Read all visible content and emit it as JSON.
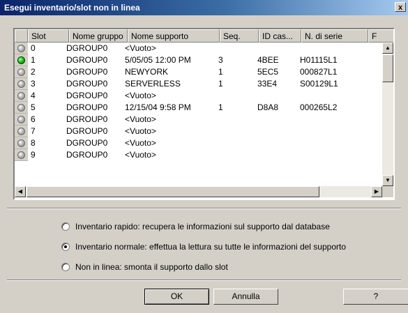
{
  "window": {
    "title": "Esegui inventario/slot non in linea",
    "close_label": "x"
  },
  "grid": {
    "columns": [
      "Slot",
      "Nome gruppo",
      "Nome supporto",
      "Seq.",
      "ID cas...",
      "N. di serie",
      "F"
    ],
    "rows": [
      {
        "slot": "0",
        "group": "DGROUP0",
        "media": "<Vuoto>",
        "seq": "",
        "cas": "",
        "serial": "",
        "active": false
      },
      {
        "slot": "1",
        "group": "DGROUP0",
        "media": "5/05/05 12:00 PM",
        "seq": "3",
        "cas": "4BEE",
        "serial": "H01115L1",
        "active": true
      },
      {
        "slot": "2",
        "group": "DGROUP0",
        "media": "NEWYORK",
        "seq": "1",
        "cas": "5EC5",
        "serial": "000827L1",
        "active": false
      },
      {
        "slot": "3",
        "group": "DGROUP0",
        "media": "SERVERLESS",
        "seq": "1",
        "cas": "33E4",
        "serial": "S00129L1",
        "active": false
      },
      {
        "slot": "4",
        "group": "DGROUP0",
        "media": "<Vuoto>",
        "seq": "",
        "cas": "",
        "serial": "",
        "active": false
      },
      {
        "slot": "5",
        "group": "DGROUP0",
        "media": "12/15/04 9:58 PM",
        "seq": "1",
        "cas": "D8A8",
        "serial": "000265L2",
        "active": false
      },
      {
        "slot": "6",
        "group": "DGROUP0",
        "media": "<Vuoto>",
        "seq": "",
        "cas": "",
        "serial": "",
        "active": false
      },
      {
        "slot": "7",
        "group": "DGROUP0",
        "media": "<Vuoto>",
        "seq": "",
        "cas": "",
        "serial": "",
        "active": false
      },
      {
        "slot": "8",
        "group": "DGROUP0",
        "media": "<Vuoto>",
        "seq": "",
        "cas": "",
        "serial": "",
        "active": false
      },
      {
        "slot": "9",
        "group": "DGROUP0",
        "media": "<Vuoto>",
        "seq": "",
        "cas": "",
        "serial": "",
        "active": false
      }
    ]
  },
  "options": [
    {
      "label": "Inventario rapido: recupera le informazioni sul supporto dal database",
      "selected": false
    },
    {
      "label": "Inventario normale: effettua la lettura su tutte le informazioni del supporto",
      "selected": true
    },
    {
      "label": "Non in linea: smonta il supporto dallo slot",
      "selected": false
    }
  ],
  "buttons": {
    "ok": "OK",
    "cancel": "Annulla",
    "help": "?"
  },
  "colors": {
    "led_on": "#19d419",
    "title_bar": "#0a246a"
  }
}
